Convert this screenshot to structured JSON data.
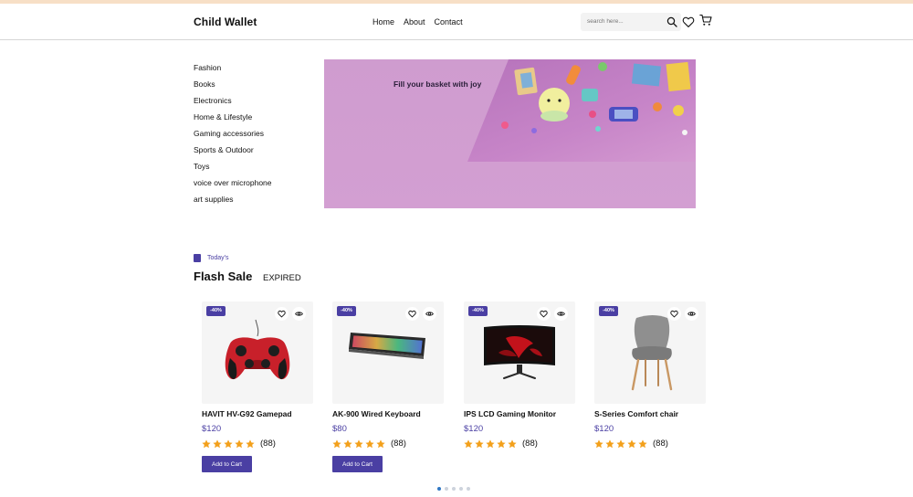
{
  "header": {
    "brand": "Child Wallet",
    "nav": [
      "Home",
      "About",
      "Contact"
    ],
    "search_placeholder": "search here...",
    "icons": [
      "search-icon",
      "heart-icon",
      "cart-icon"
    ]
  },
  "categories": [
    "Fashion",
    "Books",
    "Electronics",
    "Home & Lifestyle",
    "Gaming accessories",
    "Sports & Outdoor",
    "Toys",
    "voice over microphone",
    "art supplies"
  ],
  "banner": {
    "tagline": "Fill your basket with joy"
  },
  "flash": {
    "tag": "Today's",
    "title": "Flash Sale",
    "status": "EXPIRED",
    "accent": "#4a3fa3"
  },
  "products": [
    {
      "discount": "-40%",
      "name": "HAVIT HV-G92 Gamepad",
      "price": "$120",
      "rating_count": "(88)",
      "stars": 5,
      "cta": "Add to Cart",
      "icon": "gamepad"
    },
    {
      "discount": "-40%",
      "name": "AK-900 Wired Keyboard",
      "price": "$80",
      "rating_count": "(88)",
      "stars": 5,
      "cta": "Add to Cart",
      "icon": "keyboard"
    },
    {
      "discount": "-40%",
      "name": "IPS LCD Gaming Monitor",
      "price": "$120",
      "rating_count": "(88)",
      "stars": 5,
      "cta": "",
      "icon": "monitor"
    },
    {
      "discount": "-40%",
      "name": "S-Series Comfort chair",
      "price": "$120",
      "rating_count": "(88)",
      "stars": 5,
      "cta": "",
      "icon": "chair"
    }
  ],
  "pagination": {
    "active": 1,
    "total": 5
  }
}
